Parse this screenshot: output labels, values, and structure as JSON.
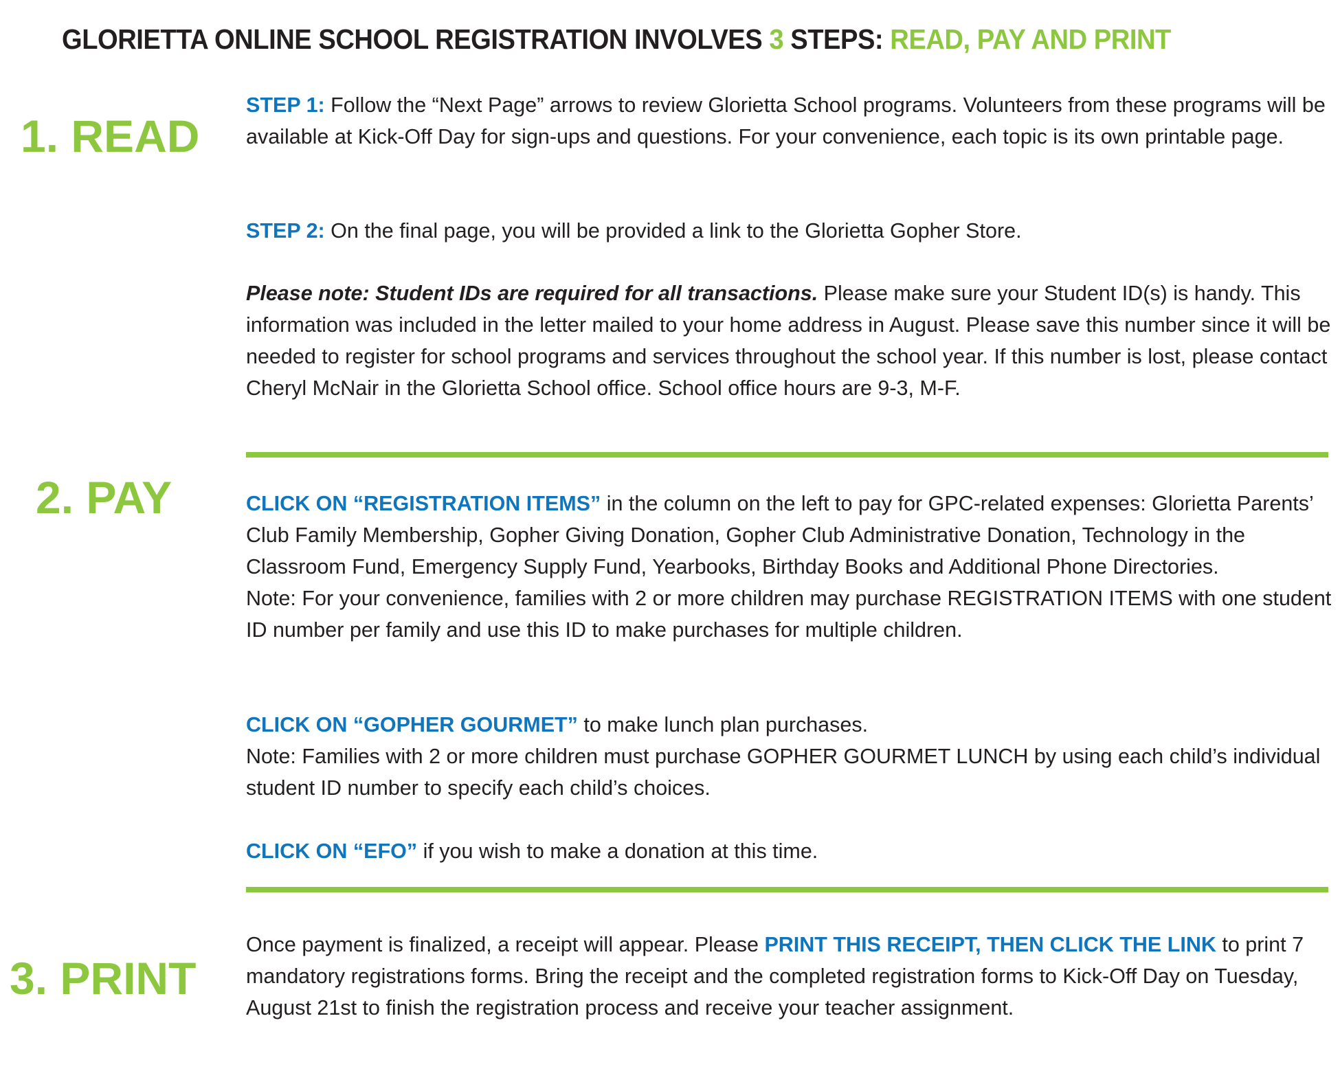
{
  "title": {
    "part1": "GLORIETTA ONLINE SCHOOL REGISTRATION INVOLVES ",
    "number": "3",
    "part2": " STEPS: ",
    "part3": "READ, PAY AND PRINT"
  },
  "read": {
    "heading": "1. READ",
    "step1_label": "STEP 1:",
    "step1_text": " Follow the “Next Page” arrows to review Glorietta School programs. Volunteers from these programs will be available at Kick-Off Day for sign-ups and questions. For your convenience, each topic is its own printable page.",
    "step2_label": "STEP 2:",
    "step2_text": " On the final page, you will be provided a link to the Glorietta Gopher Store.",
    "note_bold": "Please note:  Student IDs are required for all transactions.",
    "note_text": " Please make sure your Student ID(s) is handy. This information was included in the letter mailed to your home address in August. Please save this number since it will be needed to register for school programs and services throughout the school year. If this number is lost, please contact Cheryl McNair in the Glorietta School office. School office hours are 9-3, M-F."
  },
  "pay": {
    "heading": "2. PAY",
    "reg_label": "CLICK ON “REGISTRATION ITEMS”",
    "reg_text": " in the column on the left to pay for GPC-related expenses: Glorietta Parents’ Club Family Membership, Gopher Giving Donation, Gopher Club Administrative Donation, Technology in the Classroom Fund, Emergency Supply Fund, Yearbooks, Birthday Books and Additional Phone Directories.",
    "reg_note": "Note: For your convenience, families with 2 or more children may purchase REGISTRATION ITEMS with one student ID number per family and use this ID to make purchases for multiple children.",
    "gourmet_label": "CLICK ON “GOPHER GOURMET”",
    "gourmet_text": " to make lunch plan purchases.",
    "gourmet_note": "Note: Families with 2 or more children must purchase GOPHER GOURMET LUNCH by using each child’s individual student ID number to specify each child’s choices.",
    "efo_label": "CLICK ON “EFO”",
    "efo_text": " if you wish to make a donation at this time."
  },
  "print": {
    "heading": "3. PRINT",
    "text1": "Once payment is finalized, a receipt will appear. Please ",
    "link_label": "PRINT THIS RECEIPT, THEN CLICK THE LINK",
    "text2": " to print 7 mandatory registrations forms. Bring the receipt and the completed registration forms to Kick-Off Day on Tuesday, August 21st to finish the registration process and receive your teacher assignment."
  },
  "colors": {
    "green": "#8dc63f",
    "blue": "#0f75bc",
    "text": "#231f20"
  }
}
